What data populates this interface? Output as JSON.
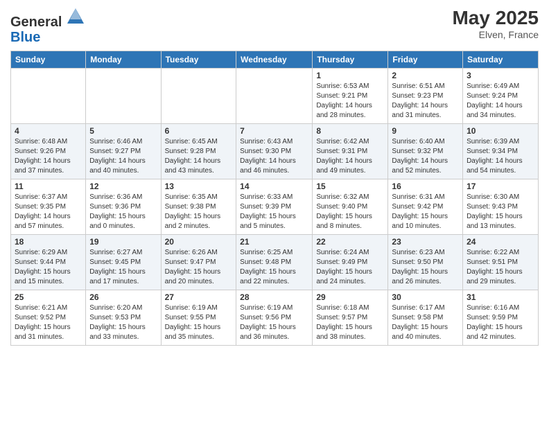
{
  "header": {
    "logo_general": "General",
    "logo_blue": "Blue",
    "month_year": "May 2025",
    "location": "Elven, France"
  },
  "weekdays": [
    "Sunday",
    "Monday",
    "Tuesday",
    "Wednesday",
    "Thursday",
    "Friday",
    "Saturday"
  ],
  "weeks": [
    [
      {
        "day": "",
        "info": ""
      },
      {
        "day": "",
        "info": ""
      },
      {
        "day": "",
        "info": ""
      },
      {
        "day": "",
        "info": ""
      },
      {
        "day": "1",
        "info": "Sunrise: 6:53 AM\nSunset: 9:21 PM\nDaylight: 14 hours\nand 28 minutes."
      },
      {
        "day": "2",
        "info": "Sunrise: 6:51 AM\nSunset: 9:23 PM\nDaylight: 14 hours\nand 31 minutes."
      },
      {
        "day": "3",
        "info": "Sunrise: 6:49 AM\nSunset: 9:24 PM\nDaylight: 14 hours\nand 34 minutes."
      }
    ],
    [
      {
        "day": "4",
        "info": "Sunrise: 6:48 AM\nSunset: 9:26 PM\nDaylight: 14 hours\nand 37 minutes."
      },
      {
        "day": "5",
        "info": "Sunrise: 6:46 AM\nSunset: 9:27 PM\nDaylight: 14 hours\nand 40 minutes."
      },
      {
        "day": "6",
        "info": "Sunrise: 6:45 AM\nSunset: 9:28 PM\nDaylight: 14 hours\nand 43 minutes."
      },
      {
        "day": "7",
        "info": "Sunrise: 6:43 AM\nSunset: 9:30 PM\nDaylight: 14 hours\nand 46 minutes."
      },
      {
        "day": "8",
        "info": "Sunrise: 6:42 AM\nSunset: 9:31 PM\nDaylight: 14 hours\nand 49 minutes."
      },
      {
        "day": "9",
        "info": "Sunrise: 6:40 AM\nSunset: 9:32 PM\nDaylight: 14 hours\nand 52 minutes."
      },
      {
        "day": "10",
        "info": "Sunrise: 6:39 AM\nSunset: 9:34 PM\nDaylight: 14 hours\nand 54 minutes."
      }
    ],
    [
      {
        "day": "11",
        "info": "Sunrise: 6:37 AM\nSunset: 9:35 PM\nDaylight: 14 hours\nand 57 minutes."
      },
      {
        "day": "12",
        "info": "Sunrise: 6:36 AM\nSunset: 9:36 PM\nDaylight: 15 hours\nand 0 minutes."
      },
      {
        "day": "13",
        "info": "Sunrise: 6:35 AM\nSunset: 9:38 PM\nDaylight: 15 hours\nand 2 minutes."
      },
      {
        "day": "14",
        "info": "Sunrise: 6:33 AM\nSunset: 9:39 PM\nDaylight: 15 hours\nand 5 minutes."
      },
      {
        "day": "15",
        "info": "Sunrise: 6:32 AM\nSunset: 9:40 PM\nDaylight: 15 hours\nand 8 minutes."
      },
      {
        "day": "16",
        "info": "Sunrise: 6:31 AM\nSunset: 9:42 PM\nDaylight: 15 hours\nand 10 minutes."
      },
      {
        "day": "17",
        "info": "Sunrise: 6:30 AM\nSunset: 9:43 PM\nDaylight: 15 hours\nand 13 minutes."
      }
    ],
    [
      {
        "day": "18",
        "info": "Sunrise: 6:29 AM\nSunset: 9:44 PM\nDaylight: 15 hours\nand 15 minutes."
      },
      {
        "day": "19",
        "info": "Sunrise: 6:27 AM\nSunset: 9:45 PM\nDaylight: 15 hours\nand 17 minutes."
      },
      {
        "day": "20",
        "info": "Sunrise: 6:26 AM\nSunset: 9:47 PM\nDaylight: 15 hours\nand 20 minutes."
      },
      {
        "day": "21",
        "info": "Sunrise: 6:25 AM\nSunset: 9:48 PM\nDaylight: 15 hours\nand 22 minutes."
      },
      {
        "day": "22",
        "info": "Sunrise: 6:24 AM\nSunset: 9:49 PM\nDaylight: 15 hours\nand 24 minutes."
      },
      {
        "day": "23",
        "info": "Sunrise: 6:23 AM\nSunset: 9:50 PM\nDaylight: 15 hours\nand 26 minutes."
      },
      {
        "day": "24",
        "info": "Sunrise: 6:22 AM\nSunset: 9:51 PM\nDaylight: 15 hours\nand 29 minutes."
      }
    ],
    [
      {
        "day": "25",
        "info": "Sunrise: 6:21 AM\nSunset: 9:52 PM\nDaylight: 15 hours\nand 31 minutes."
      },
      {
        "day": "26",
        "info": "Sunrise: 6:20 AM\nSunset: 9:53 PM\nDaylight: 15 hours\nand 33 minutes."
      },
      {
        "day": "27",
        "info": "Sunrise: 6:19 AM\nSunset: 9:55 PM\nDaylight: 15 hours\nand 35 minutes."
      },
      {
        "day": "28",
        "info": "Sunrise: 6:19 AM\nSunset: 9:56 PM\nDaylight: 15 hours\nand 36 minutes."
      },
      {
        "day": "29",
        "info": "Sunrise: 6:18 AM\nSunset: 9:57 PM\nDaylight: 15 hours\nand 38 minutes."
      },
      {
        "day": "30",
        "info": "Sunrise: 6:17 AM\nSunset: 9:58 PM\nDaylight: 15 hours\nand 40 minutes."
      },
      {
        "day": "31",
        "info": "Sunrise: 6:16 AM\nSunset: 9:59 PM\nDaylight: 15 hours\nand 42 minutes."
      }
    ]
  ]
}
